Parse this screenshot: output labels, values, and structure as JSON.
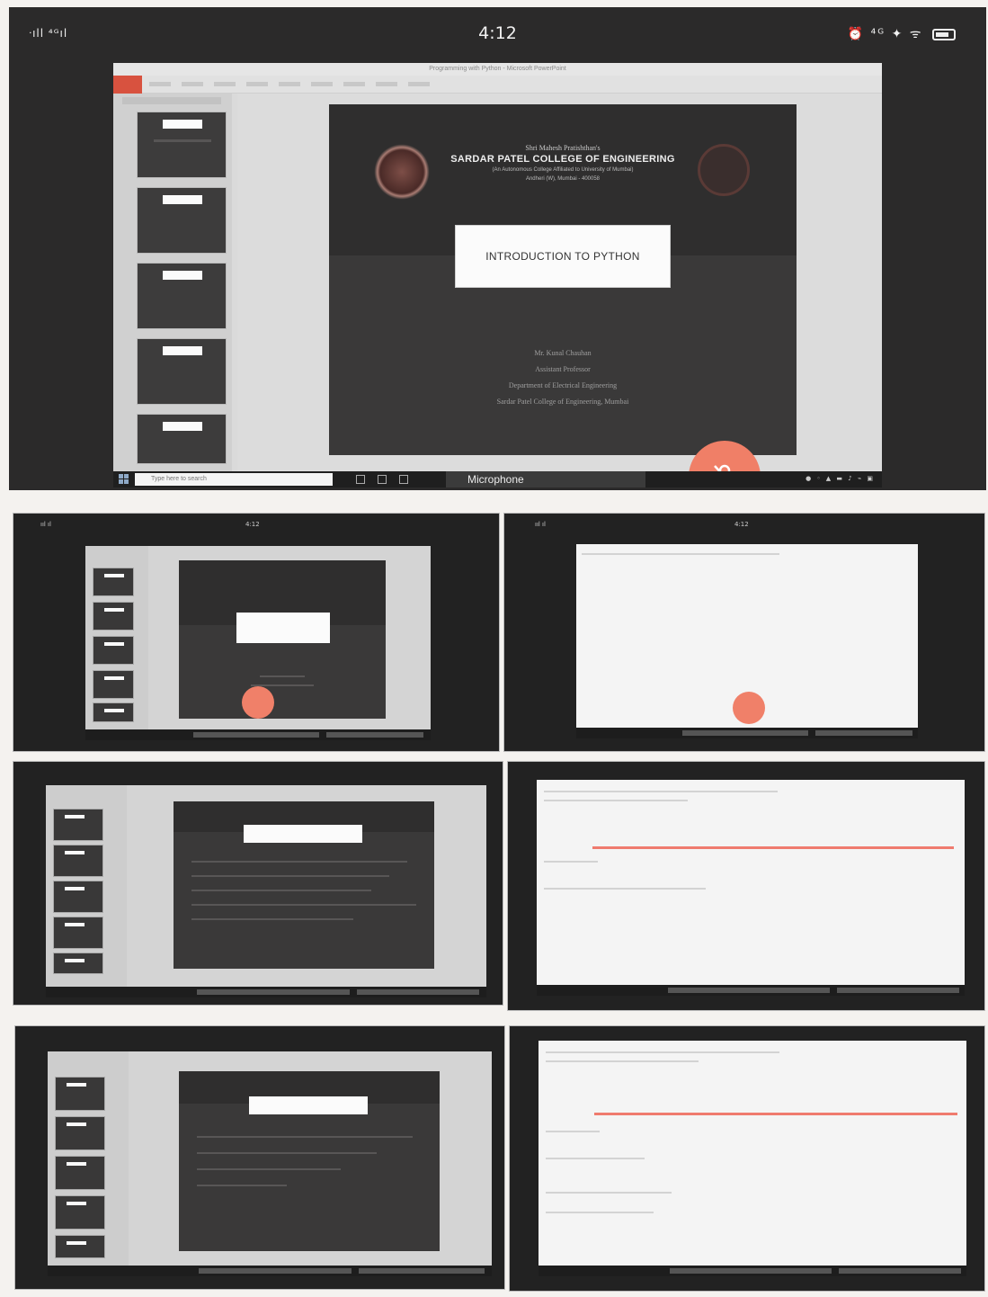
{
  "status_bar": {
    "signal": "ᐧıll ⁴ᴳıl",
    "time": "4:12",
    "icons": "⏰ ⁴ᴳ ✦ ᯤ"
  },
  "ppt": {
    "window_title": "Programming with Python - Microsoft PowerPoint",
    "taskbar_search_placeholder": "Type here to search",
    "microphone_label": "Microphone"
  },
  "slide": {
    "affiliation": "Shri Mahesh Pratishthan's",
    "college_name": "SARDAR PATEL COLLEGE OF ENGINEERING",
    "subline_1": "(An Autonomous College Affiliated to University of Mumbai)",
    "subline_2": "Andheri (W), Mumbai - 400058",
    "title": "INTRODUCTION TO PYTHON",
    "presenter_name": "Mr. Kunal Chauhan",
    "presenter_role": "Assistant Professor",
    "department": "Department of Electrical Engineering",
    "college_line": "Sardar Patel College of Engineering, Mumbai"
  },
  "colors": {
    "mic_button": "#f07f67",
    "slide_background": "#3a3939",
    "file_tab": "#d8523f",
    "highlight_line": "#ef7b6e"
  },
  "icons": [
    "signal-icon",
    "alarm-icon",
    "wifi-icon",
    "battery-icon",
    "mic-muted-icon",
    "windows-icon"
  ]
}
